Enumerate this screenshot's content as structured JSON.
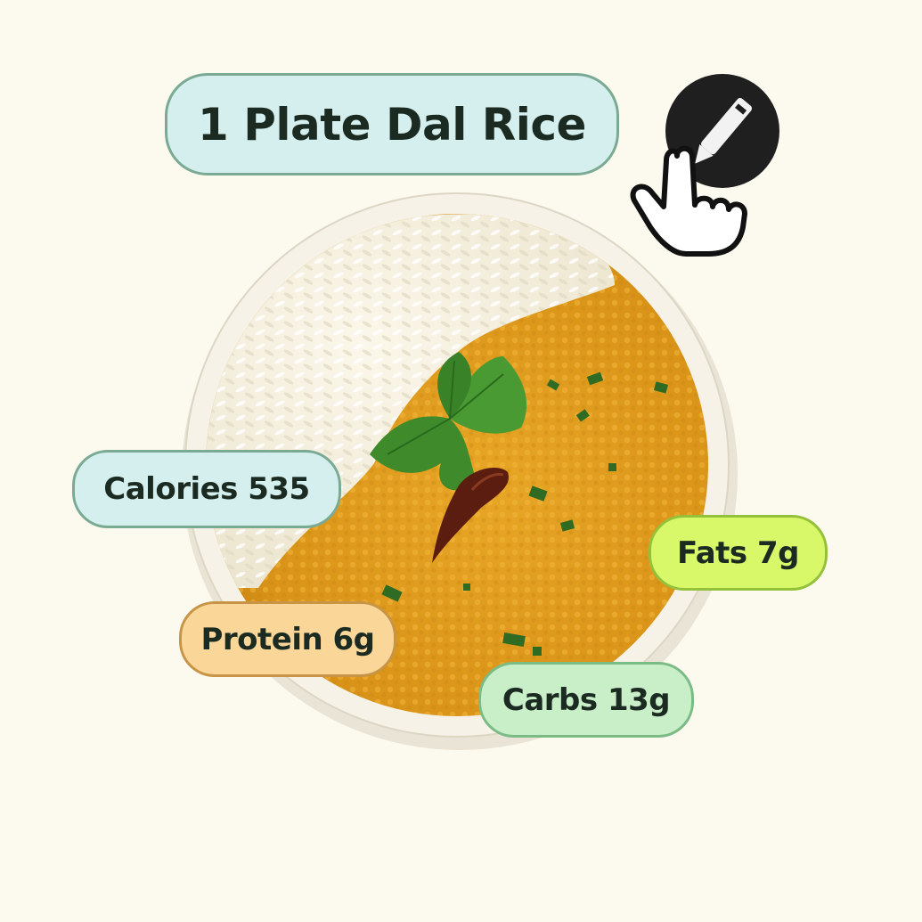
{
  "title": "1 Plate Dal Rice",
  "nutrients": {
    "calories": "Calories 535",
    "fats": "Fats 7g",
    "protein": "Protein 6g",
    "carbs": "Carbs 13g"
  },
  "icons": {
    "tap": "tap-edit-icon",
    "food": "dal-rice-bowl-image"
  },
  "colors": {
    "background": "#fcf9ee",
    "title_bg": "#d5efee",
    "calories_bg": "#d5efee",
    "fats_bg": "#d8f86a",
    "protein_bg": "#fad799",
    "carbs_bg": "#c8efc8"
  }
}
